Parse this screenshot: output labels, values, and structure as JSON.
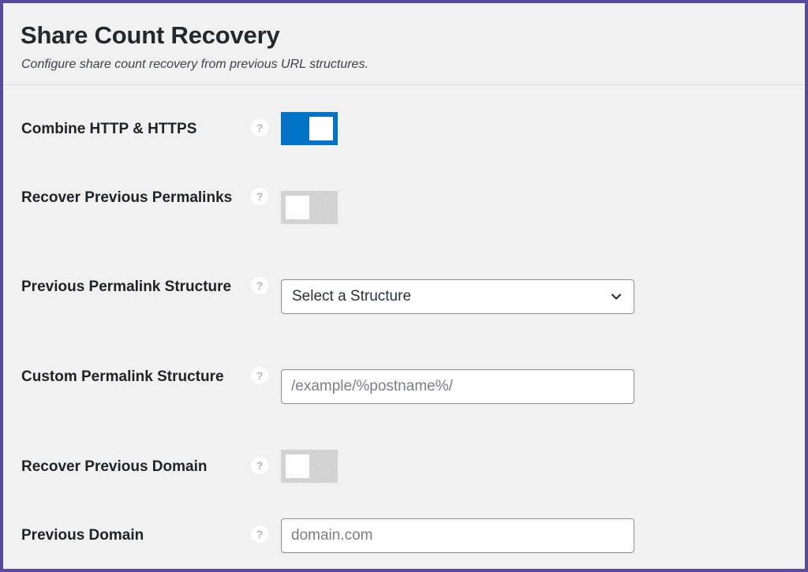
{
  "page": {
    "title": "Share Count Recovery",
    "subtitle": "Configure share count recovery from previous URL structures."
  },
  "help_glyph": "?",
  "settings": {
    "combine_http_https": {
      "label": "Combine HTTP & HTTPS",
      "enabled": true
    },
    "recover_previous_permalinks": {
      "label": "Recover Previous Permalinks",
      "enabled": false
    },
    "previous_permalink_structure": {
      "label": "Previous Permalink Structure",
      "selected": "Select a Structure"
    },
    "custom_permalink_structure": {
      "label": "Custom Permalink Structure",
      "placeholder": "/example/%postname%/",
      "value": ""
    },
    "recover_previous_domain": {
      "label": "Recover Previous Domain",
      "enabled": false
    },
    "previous_domain": {
      "label": "Previous Domain",
      "placeholder": "domain.com",
      "value": ""
    }
  },
  "colors": {
    "toggle_on": "#0073c7",
    "toggle_off": "#d6d6d6",
    "frame_border": "#5a4a9c",
    "background": "#f1f1f1"
  }
}
